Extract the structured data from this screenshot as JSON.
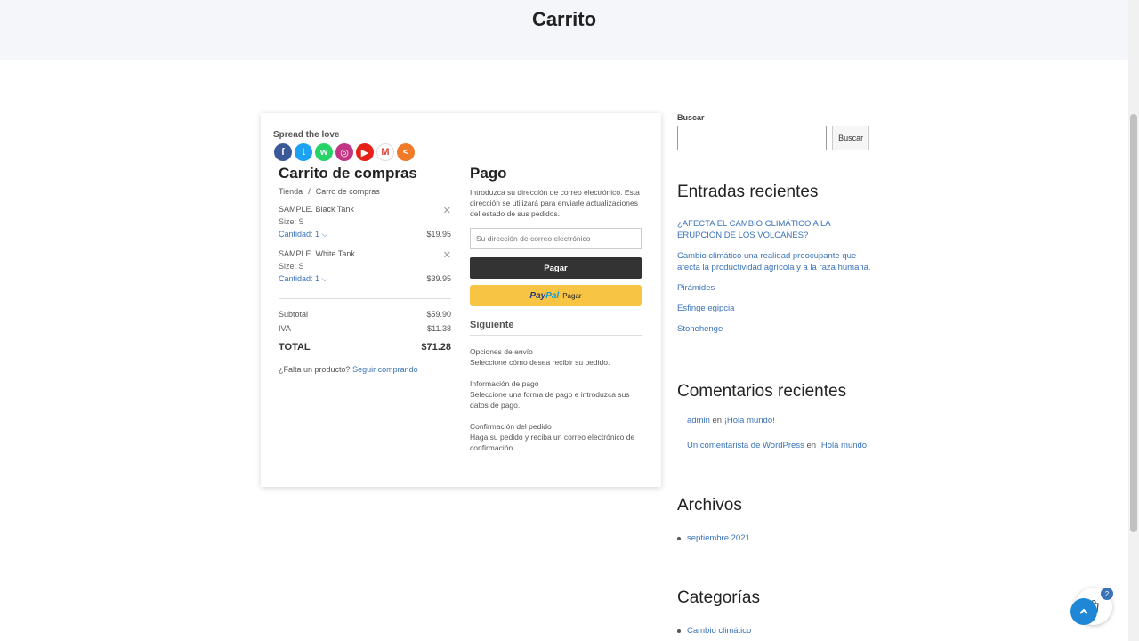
{
  "header": {
    "title": "Carrito"
  },
  "share": {
    "label": "Spread the love",
    "buttons": [
      {
        "name": "facebook-icon",
        "color": "#3b5998",
        "glyph": "f"
      },
      {
        "name": "twitter-icon",
        "color": "#1da1f2",
        "glyph": "t"
      },
      {
        "name": "whatsapp-icon",
        "color": "#25d366",
        "glyph": "w"
      },
      {
        "name": "instagram-icon",
        "color": "#c13584",
        "glyph": "◎"
      },
      {
        "name": "youtube-icon",
        "color": "#e62117",
        "glyph": "▶"
      },
      {
        "name": "gmail-icon",
        "color": "#ffffff",
        "glyph": "M"
      },
      {
        "name": "share-more-icon",
        "color": "#f07a28",
        "glyph": "<"
      }
    ]
  },
  "cart": {
    "title": "Carrito de compras",
    "breadcrumb": [
      "Tienda",
      "/",
      "Carro de compras"
    ],
    "items": [
      {
        "name": "SAMPLE. Black Tank",
        "size": "Size: S",
        "qty": "Cantidad: 1",
        "price": "$19.95"
      },
      {
        "name": "SAMPLE. White Tank",
        "size": "Size: S",
        "qty": "Cantidad: 1",
        "price": "$39.95"
      }
    ],
    "subtotal_label": "Subtotal",
    "subtotal": "$59.90",
    "iva_label": "IVA",
    "iva": "$11.38",
    "total_label": "TOTAL",
    "total": "$71.28",
    "missing_text": "¿Falta un producto?",
    "continue_link": "Seguir comprando"
  },
  "payment": {
    "title": "Pago",
    "description": "Introduzca su dirección de correo electrónico. Esta dirección se utilizará para enviarle actualizaciones del estado de sus pedidos.",
    "email_placeholder": "Su dirección de correo electrónico",
    "pay_button": "Pagar",
    "paypal_brand_1": "Pay",
    "paypal_brand_2": "Pal",
    "paypal_label": "Pagar",
    "next_title": "Siguiente",
    "steps": [
      {
        "title": "Opciones de envío",
        "text": "Seleccione cómo desea recibir su pedido."
      },
      {
        "title": "Información de pago",
        "text": "Seleccione una forma de pago e introduzca sus datos de pago."
      },
      {
        "title": "Confirmación del pedido",
        "text": "Haga su pedido y reciba un correo electrónico de confirmación."
      }
    ]
  },
  "sidebar": {
    "search_label": "Buscar",
    "search_button": "Buscar",
    "recent_posts_title": "Entradas recientes",
    "recent_posts": [
      "¿AFECTA EL CAMBIO CLIMÁTICO A LA ERUPCIÓN DE LOS VOLCANES?",
      "Cambio climático una realidad preocupante que afecta la productividad agrícola y a la raza humana.",
      "Pirámides",
      "Esfinge egipcia",
      "Stonehenge"
    ],
    "recent_comments_title": "Comentarios recientes",
    "recent_comments": [
      {
        "author": "admin",
        "on": "en",
        "post": "¡Hola mundo!"
      },
      {
        "author": "Un comentarista de WordPress",
        "on": "en",
        "post": "¡Hola mundo!"
      }
    ],
    "archives_title": "Archivos",
    "archives": [
      "septiembre 2021"
    ],
    "categories_title": "Categorías",
    "categories": [
      "Cambio climático"
    ]
  },
  "floating_cart": {
    "count": "2"
  }
}
